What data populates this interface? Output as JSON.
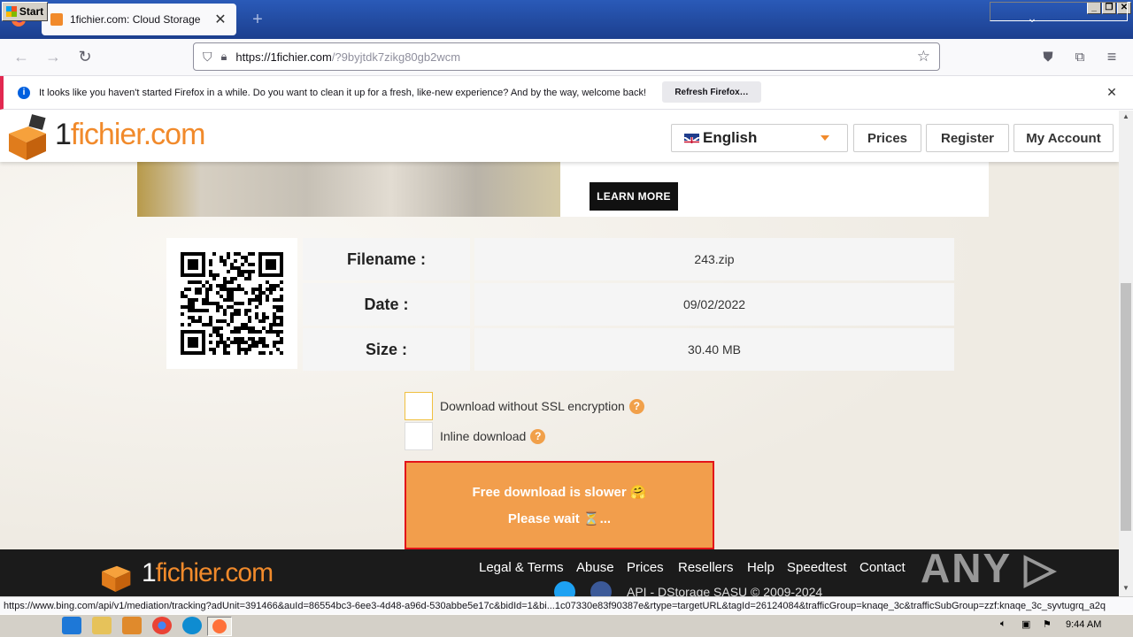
{
  "browser": {
    "tab_title": "1fichier.com: Cloud Storage",
    "url_host": "https://1fichier.com",
    "url_path": "/?9byjtdk7zikg80gb2wcm"
  },
  "notification": {
    "text": "It looks like you haven't started Firefox in a while. Do you want to clean it up for a fresh, like-new experience? And by the way, welcome back!",
    "button": "Refresh Firefox…"
  },
  "site": {
    "logo_one": "1",
    "logo_rest": "fichier.com",
    "language": "English",
    "nav": [
      "Prices",
      "Register",
      "My Account"
    ],
    "ad_button": "LEARN MORE"
  },
  "file_info": {
    "rows": [
      {
        "label": "Filename :",
        "value": "243.zip"
      },
      {
        "label": "Date :",
        "value": "09/02/2022"
      },
      {
        "label": "Size :",
        "value": "30.40 MB"
      }
    ]
  },
  "options": {
    "no_ssl": "Download without SSL encryption",
    "inline": "Inline download",
    "help": "?"
  },
  "download": {
    "line1": "Free download is slower 🤗",
    "line2": "Please wait ⏳..."
  },
  "footer": {
    "links": [
      "Legal & Terms",
      "Abuse",
      "Prices",
      "Resellers",
      "Help",
      "Speedtest",
      "Contact"
    ],
    "copyright": "API - DStorage SASU © 2009-2024",
    "watermark": "ANY ▷ RUN"
  },
  "statusbar": {
    "text": "https://www.bing.com/api/v1/mediation/tracking?adUnit=391466&auId=86554bc3-6ee3-4d48-a96d-530abbe5e17c&bidId=1&bi...1c07330e83f90387e&rtype=targetURL&tagId=26124084&trafficGroup=knaqe_3c&trafficSubGroup=zzf:knaqe_3c_syvtugrq_a2q"
  },
  "taskbar": {
    "start": "Start",
    "clock": "9:44 AM"
  },
  "colors": {
    "accent": "#f18a2b",
    "download_bg": "#f29e4c",
    "download_border": "#e3141a"
  }
}
